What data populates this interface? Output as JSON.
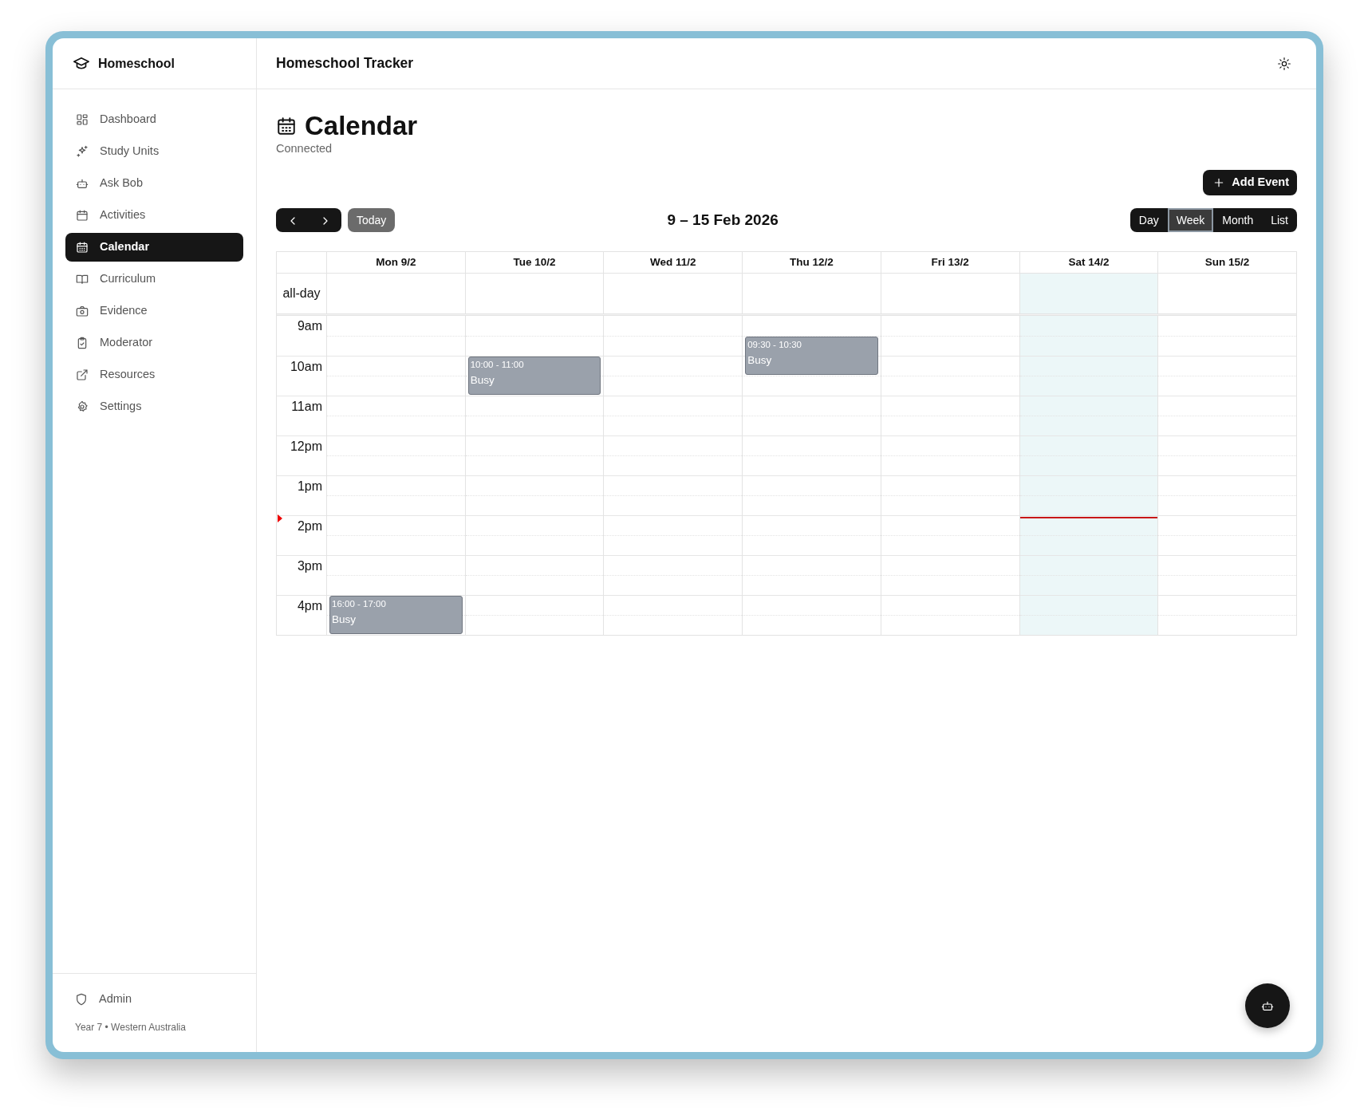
{
  "sidebar": {
    "brand": "Homeschool",
    "items": [
      {
        "label": "Dashboard",
        "selected": false
      },
      {
        "label": "Study Units",
        "selected": false
      },
      {
        "label": "Ask Bob",
        "selected": false
      },
      {
        "label": "Activities",
        "selected": false
      },
      {
        "label": "Calendar",
        "selected": true
      },
      {
        "label": "Curriculum",
        "selected": false
      },
      {
        "label": "Evidence",
        "selected": false
      },
      {
        "label": "Moderator",
        "selected": false
      },
      {
        "label": "Resources",
        "selected": false
      },
      {
        "label": "Settings",
        "selected": false
      }
    ],
    "footer": {
      "admin": "Admin",
      "info": "Year 7 • Western Australia"
    }
  },
  "header": {
    "title": "Homeschool Tracker"
  },
  "page": {
    "title": "Calendar",
    "subtitle": "Connected"
  },
  "toolbar": {
    "add_button": "Add Event",
    "today_button": "Today",
    "range_title": "9 – 15 Feb 2026",
    "views": [
      {
        "label": "Day",
        "selected": false
      },
      {
        "label": "Week",
        "selected": true
      },
      {
        "label": "Month",
        "selected": false
      },
      {
        "label": "List",
        "selected": false
      }
    ]
  },
  "calendar": {
    "all_day_label": "all-day",
    "hours": [
      "9am",
      "10am",
      "11am",
      "12pm",
      "1pm",
      "2pm",
      "3pm",
      "4pm"
    ],
    "days": [
      {
        "label": "Mon 9/2",
        "today": false,
        "events": [
          {
            "time": "16:00 - 17:00",
            "title": "Busy"
          }
        ]
      },
      {
        "label": "Tue 10/2",
        "today": false,
        "events": [
          {
            "time": "10:00 - 11:00",
            "title": "Busy"
          }
        ]
      },
      {
        "label": "Wed 11/2",
        "today": false
      },
      {
        "label": "Thu 12/2",
        "today": false,
        "events": [
          {
            "time": "09:30 - 10:30",
            "title": "Busy"
          }
        ]
      },
      {
        "label": "Fri 13/2",
        "today": false
      },
      {
        "label": "Sat 14/2",
        "today": true
      },
      {
        "label": "Sun 15/2",
        "today": false
      }
    ],
    "now_indicator": {
      "level": 0.635
    }
  }
}
